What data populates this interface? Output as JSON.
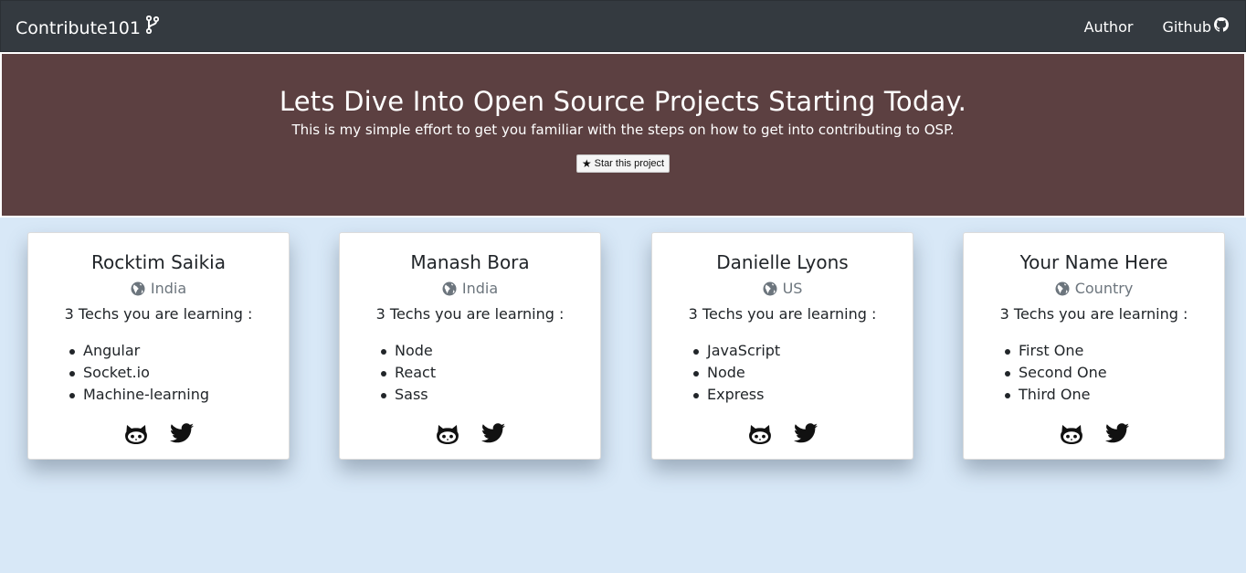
{
  "navbar": {
    "brand": "Contribute101",
    "brand_icon": "code-branch-icon",
    "links": [
      {
        "label": "Author"
      },
      {
        "label": "Github",
        "icon": "github-icon"
      }
    ]
  },
  "hero": {
    "title": "Lets Dive Into Open Source Projects Starting Today.",
    "subtitle": "This is my simple effort to get you familiar with the steps on how to get into contributing to OSP.",
    "star_button": "Star this project",
    "background": "#5c4041"
  },
  "cards": [
    {
      "name": "Rocktim Saikia",
      "country": "India",
      "techs_label": "3 Techs you are learning :",
      "techs": [
        "Angular",
        "Socket.io",
        "Machine-learning"
      ]
    },
    {
      "name": "Manash Bora",
      "country": "India",
      "techs_label": "3 Techs you are learning :",
      "techs": [
        "Node",
        "React",
        "Sass"
      ]
    },
    {
      "name": "Danielle Lyons",
      "country": "US",
      "techs_label": "3 Techs you are learning :",
      "techs": [
        "JavaScript",
        "Node",
        "Express"
      ]
    },
    {
      "name": "Your Name Here",
      "country": "Country",
      "techs_label": "3 Techs you are learning :",
      "techs": [
        "First One",
        "Second One",
        "Third One"
      ]
    }
  ],
  "colors": {
    "navbar": "#343a40",
    "page_background": "#d8e8f7",
    "muted_text": "#6c757d"
  }
}
